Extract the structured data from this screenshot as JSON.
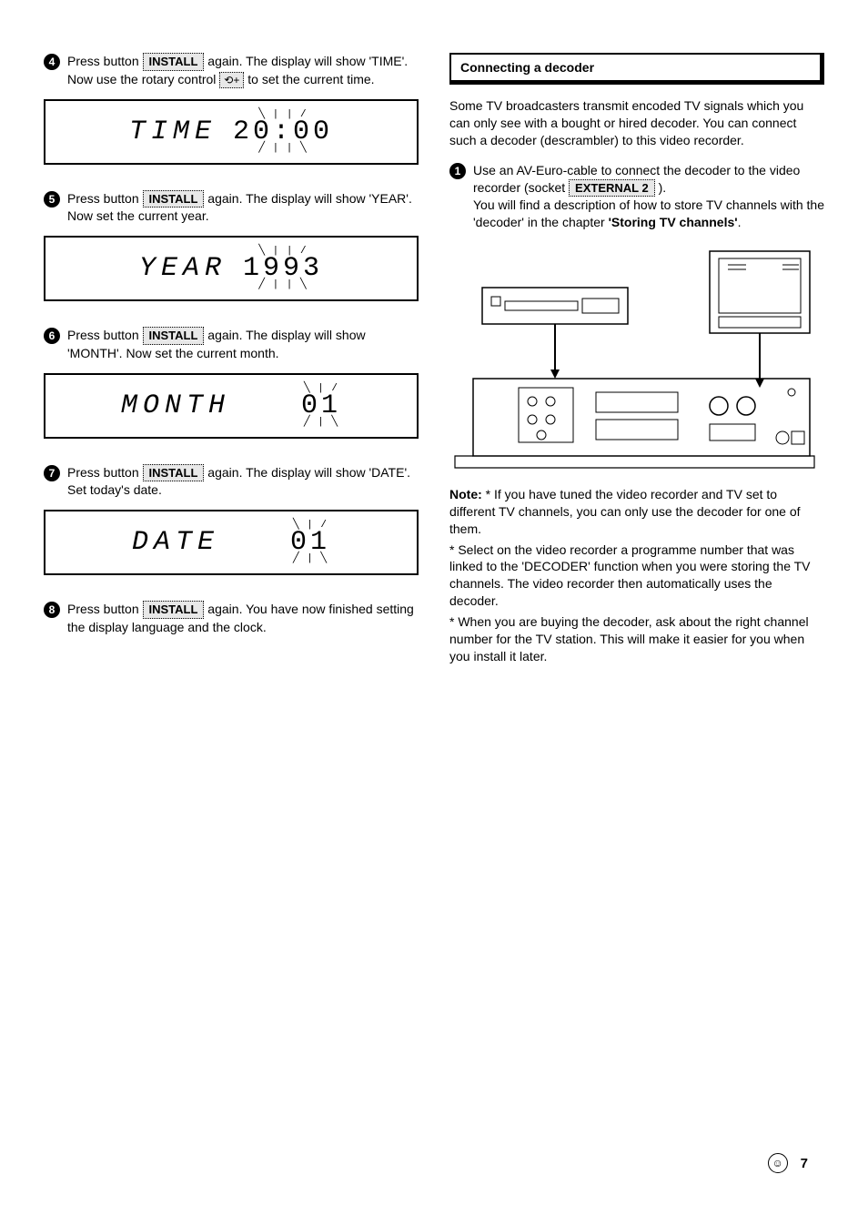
{
  "left": {
    "steps": [
      {
        "num": "4",
        "pre": "Press button ",
        "btn": "INSTALL",
        "mid1": " again. The display will show 'TIME'. Now use the rotary control ",
        "rotary": "⟲+",
        "mid2": " to set the current time."
      },
      {
        "num": "5",
        "pre": "Press button ",
        "btn": "INSTALL",
        "mid1": " again. The display will show 'YEAR'. Now set the current year."
      },
      {
        "num": "6",
        "pre": "Press button ",
        "btn": "INSTALL",
        "mid1": " again. The display will show 'MONTH'. Now set the current month."
      },
      {
        "num": "7",
        "pre": "Press button ",
        "btn": "INSTALL",
        "mid1": " again. The display will show 'DATE'. Set today's date."
      },
      {
        "num": "8",
        "pre": "Press button ",
        "btn": "INSTALL",
        "mid1": " again. You have now finished setting the display language and the clock."
      }
    ],
    "displays": [
      {
        "label": "TIME",
        "value": "20:00"
      },
      {
        "label": "YEAR",
        "value": "1993"
      },
      {
        "label": "MONTH",
        "value": "01"
      },
      {
        "label": "DATE",
        "value": "01"
      }
    ]
  },
  "right": {
    "heading": "Connecting a decoder",
    "intro": "Some TV broadcasters transmit encoded TV signals which you can only see with a bought or hired decoder. You can connect such a decoder (descrambler) to this video recorder.",
    "step1": {
      "num": "1",
      "pre": "Use an AV-Euro-cable to connect the decoder to the video recorder (socket ",
      "ext": "EXTERNAL 2",
      "post1": " ).",
      "post2": "You will find a description of how to store TV channels with the 'decoder' in the chapter ",
      "bold": "'Storing TV channels'",
      "post3": "."
    },
    "notes": [
      "Note: * If you have tuned the video recorder and TV set to different TV channels, you can only use the decoder for one of them.",
      "* Select on the video recorder a programme number that was linked to the 'DECODER' function when you were storing the TV channels. The video recorder then automatically uses the decoder.",
      "* When you are buying the decoder, ask about the right channel number for the TV station. This will make it easier for you when you install it later."
    ]
  },
  "page_number": "7"
}
